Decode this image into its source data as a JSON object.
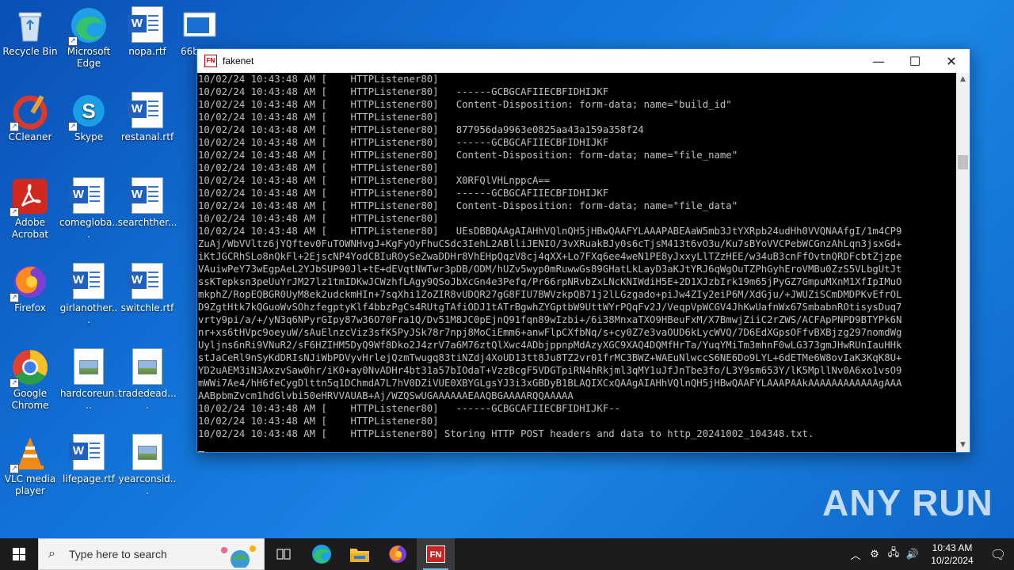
{
  "desktop": {
    "icons": [
      {
        "label": "Recycle Bin",
        "icon": "recycle-bin-icon"
      },
      {
        "label": "Microsoft Edge",
        "icon": "edge-icon"
      },
      {
        "label": "nopa.rtf",
        "icon": "word-doc-icon"
      },
      {
        "label": "66b",
        "icon": "window-app-icon"
      },
      {
        "label": "CCleaner",
        "icon": "ccleaner-icon"
      },
      {
        "label": "Skype",
        "icon": "skype-icon"
      },
      {
        "label": "restanal.rtf",
        "icon": "word-doc-icon"
      },
      {
        "label": "Adobe Acrobat",
        "icon": "acrobat-icon"
      },
      {
        "label": "comegloba...",
        "icon": "word-doc-icon"
      },
      {
        "label": "searchther...",
        "icon": "word-doc-icon"
      },
      {
        "label": "Firefox",
        "icon": "firefox-icon"
      },
      {
        "label": "girlanother...",
        "icon": "word-doc-icon"
      },
      {
        "label": "switchle.rtf",
        "icon": "word-doc-icon"
      },
      {
        "label": "Google Chrome",
        "icon": "chrome-icon"
      },
      {
        "label": "hardcoreun...",
        "icon": "image-file-icon"
      },
      {
        "label": "tradedead....",
        "icon": "image-file-icon"
      },
      {
        "label": "VLC media player",
        "icon": "vlc-icon"
      },
      {
        "label": "lifepage.rtf",
        "icon": "word-doc-icon"
      },
      {
        "label": "yearconsid...",
        "icon": "image-file-icon"
      }
    ]
  },
  "window": {
    "title": "fakenet",
    "app_icon_text": "FN",
    "controls": {
      "minimize": "—",
      "maximize": "☐",
      "close": "✕"
    }
  },
  "console": {
    "lines": [
      "10/02/24 10:43:48 AM [    HTTPListener80]",
      "10/02/24 10:43:48 AM [    HTTPListener80]   ------GCBGCAFIIECBFIDHIJKF",
      "10/02/24 10:43:48 AM [    HTTPListener80]   Content-Disposition: form-data; name=\"build_id\"",
      "10/02/24 10:43:48 AM [    HTTPListener80]",
      "10/02/24 10:43:48 AM [    HTTPListener80]   877956da9963e0825aa43a159a358f24",
      "10/02/24 10:43:48 AM [    HTTPListener80]   ------GCBGCAFIIECBFIDHIJKF",
      "10/02/24 10:43:48 AM [    HTTPListener80]   Content-Disposition: form-data; name=\"file_name\"",
      "10/02/24 10:43:48 AM [    HTTPListener80]",
      "10/02/24 10:43:48 AM [    HTTPListener80]   X0RFQlVHLnppcA==",
      "10/02/24 10:43:48 AM [    HTTPListener80]   ------GCBGCAFIIECBFIDHIJKF",
      "10/02/24 10:43:48 AM [    HTTPListener80]   Content-Disposition: form-data; name=\"file_data\"",
      "10/02/24 10:43:48 AM [    HTTPListener80]",
      "10/02/24 10:43:48 AM [    HTTPListener80]   UEsDBBQAAgAIAHhVQlnQH5jHBwQAAFYLAAAPABEAaW5mb3JtYXRpb24udHh0VVQNAAfgI/1m4CP9",
      "ZuAj/WbVVltz6jYQftev0FuTOWNHvgJ+KgFyOyFhuCSdc3IehL2ABlliJENIO/3vXRuakBJy0s6cTjsM413t6vO3u/Ku7sBYoVVCPebWCGnzAhLqn3jsxGd+",
      "iKtJGCRhSLo8nQkFl+2EjscNP4YodCBIuROySeZwaDDHr8VhEHpQqzV8cj4qXX+Lo7FXq6ee4weN1PE8yJxxyLlTZzHEE/w34uB3cnFfOvtnQRDFcbtZjzpe",
      "VAuiwPeY73wEgpAeL2YJbSUP90Jl+tE+dEVqtNWTwr3pDB/ODM/hUZv5wyp0mRuwwGs89GHatLkLayD3aKJtYRJ6qWgOuTZPhGyhEroVMBu0ZzS5VLbgUtJt",
      "ssKTepksn3peUuYrJM27lz1tmIDKwJCWzhfLAgy9QSoJbXcGn4e3Pefq/Pr66rpNRvbZxLNcKNIWdiH5E+2D1XJzbIrk19m65jPyGZ7GmpuMXnM1XfIpIMuO",
      "mkphZ/RopEQBGR0UyM8ek2udckmHIn+7sqXhi1ZoZIR8vUDQR27gG8FIU7BWVzkpQB71j2lLGzgado+piJw4ZIy2eiP6M/XdGju/+JWUZiSCmDMDPKvEfrOL",
      "D9ZgtHtk7kQGuoWvSOhzfegptyKlf4bbzPgCs4RUtgTAfiODJ1tATrBgwhZYGptbW9UttWYrPQqFv2J/VeqpVpWCGV4JhKwUafnWx67SmbabnROtisysDuq7",
      "vrty9pi/a/+/yN3q6NPyrGIpy87w36O70Fra1Q/Dv51M8JC0pEjnQ91fqn89wIzbi+/6i38MnxaTXO9HBeuFxM/X7BmwjZiiC2rZWS/ACFApPNPD9BTYPk6N",
      "nr+xs6tHVpc9oeyuW/sAuElnzcViz3sfK5PyJSk78r7npj8MoCiEmm6+anwFlpCXfbNq/s+cy0Z7e3vaOUD6kLycWVQ/7D6EdXGpsOFfvBXBjzg297nomdWg",
      "Uyljns6nRi9VNuR2/sF6HZIHM5DyQ9Wf8Dko2J4zrV7a6M76ztQlXwc4ADbjppnpMdAzyXGC9XAQ4DQMfHrTa/YuqYMiTm3mhnF0wLG373gmJHwRUnIauHHk",
      "stJaCeRl9nSyKdDRIsNJiWbPDVyvHrlejQzmTwugq83tiNZdj4XoUD13tt8Ju8TZ2vr01frMC3BWZ+WAEuNlwccS6NE6Do9LYL+6dETMe6W8ovIaK3KqK8U+",
      "YD2uAEM3iN3AxzvSaw0hr/iK0+ay0NvADHr4bt31a57bIOdaT+VzzBcgF5VDGTpiRN4hRkjml3qMY1uJfJnTbe3fo/L3Y9sm653Y/lK5MpllNv0A6xo1vsO9",
      "mWWi7Ae4/hH6feCygDlttn5q1DChmdA7L7hV0DZiVUE0XBYGLgsYJ3i3xGBDyB1BLAQIXCxQAAgAIAHhVQlnQH5jHBwQAAFYLAAAPAAkAAAAAAAAAAAAgAAA",
      "AABpbmZvcm1hdGlvbi50eHRVVAUAB+Aj/WZQSwUGAAAAAAEAAQBGAAAARQQAAAAA",
      "10/02/24 10:43:48 AM [    HTTPListener80]   ------GCBGCAFIIECBFIDHIJKF--",
      "10/02/24 10:43:48 AM [    HTTPListener80]",
      "10/02/24 10:43:48 AM [    HTTPListener80] Storing HTTP POST headers and data to http_20241002_104348.txt."
    ]
  },
  "watermark": "ANY RUN",
  "taskbar": {
    "search_placeholder": "Type here to search",
    "pinned": [
      {
        "name": "task-view-icon"
      },
      {
        "name": "edge-taskbar-icon"
      },
      {
        "name": "file-explorer-icon"
      },
      {
        "name": "firefox-taskbar-icon"
      },
      {
        "name": "fakenet-taskbar-icon",
        "label": "FN"
      }
    ],
    "clock": {
      "time": "10:43 AM",
      "date": "10/2/2024"
    }
  },
  "colors": {
    "desktop_bg": "#1272d6",
    "console_text": "#c0c0c0",
    "taskbar_bg": "#1c1c1c",
    "accent": "#76b9ed"
  }
}
